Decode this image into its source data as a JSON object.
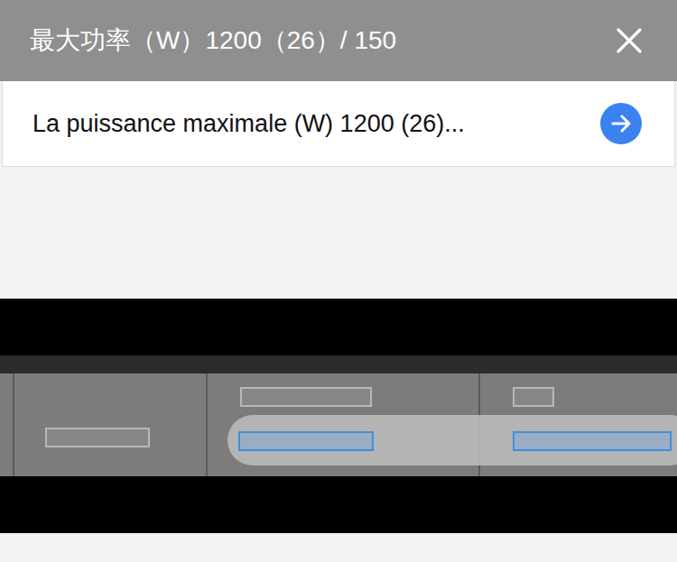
{
  "source": {
    "text": "最大功率（W）1200（26）/ 150"
  },
  "translation": {
    "text": "La puissance maximale (W) 1200 (26)..."
  },
  "camera": {
    "highlighted": true
  }
}
